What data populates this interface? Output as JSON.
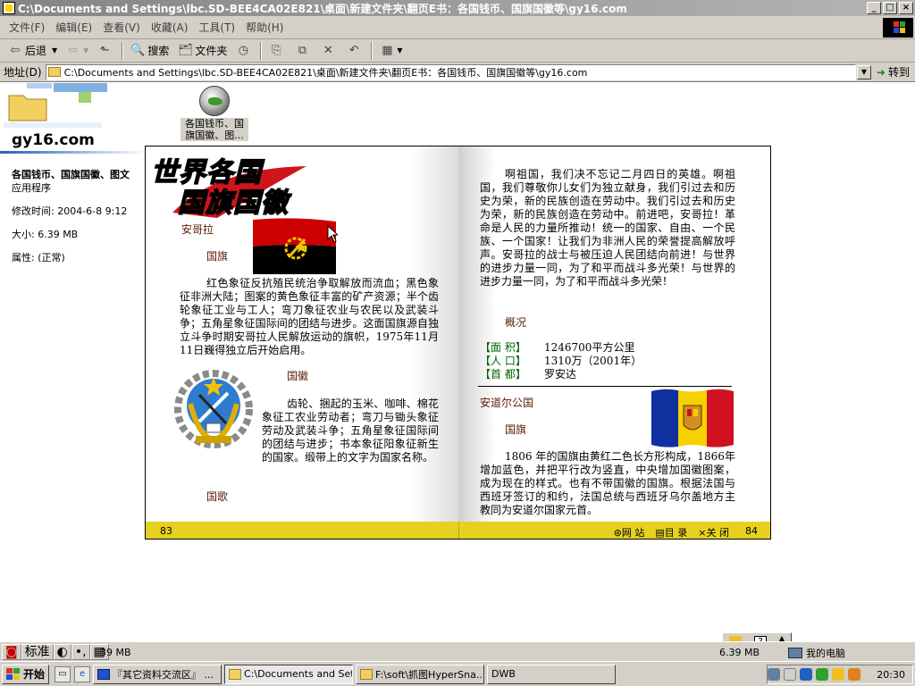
{
  "window": {
    "title": "C:\\Documents and Settings\\lbc.SD-BEE4CA02E821\\桌面\\新建文件夹\\翻页E书：各国钱币、国旗国徽等\\gy16.com",
    "buttons": {
      "minimize": "_",
      "maximize": "□",
      "close": "×"
    }
  },
  "menu": [
    "文件(F)",
    "编辑(E)",
    "查看(V)",
    "收藏(A)",
    "工具(T)",
    "帮助(H)"
  ],
  "toolbar": {
    "back": "后退",
    "search": "搜索",
    "folders": "文件夹"
  },
  "address": {
    "label": "地址(D)",
    "value": "C:\\Documents and Settings\\lbc.SD-BEE4CA02E821\\桌面\\新建文件夹\\翻页E书：各国钱币、国旗国徽等\\gy16.com",
    "go": "转到"
  },
  "info_panel": {
    "title": "gy16.com",
    "name": "各国钱币、国旗国徽、图文",
    "type": "应用程序",
    "modified": "修改时间: 2004-6-8 9:12",
    "size": "大小: 6.39 MB",
    "attributes": "属性: (正常)"
  },
  "file_icon": {
    "label": "各国钱币、国旗国徽、图..."
  },
  "book": {
    "title_line1": "世界各国",
    "title_line2": "国旗国徽",
    "left": {
      "country": "安哥拉",
      "flag_heading": "国旗",
      "flag_text": "红色象征反抗殖民统治争取解放而流血；黑色象征非洲大陆；图案的黄色象征丰富的矿产资源；半个齿轮象征工业与工人；弯刀象征农业与农民以及武装斗争；五角星象征国际间的团结与进步。这面国旗源自独立斗争时期安哥拉人民解放运动的旗帜，1975年11月11日巍得独立后开始启用。",
      "emblem_heading": "国徽",
      "emblem_text": "齿轮、捆起的玉米、咖啡、棉花象征工农业劳动者；弯刀与锄头象征劳动及武装斗争；五角星象征国际间的团结与进步；书本象征阳象征新生的国家。缎带上的文字为国家名称。",
      "anthem_heading": "国歌",
      "page_number": "83"
    },
    "right": {
      "anthem_text": "啊祖国，我们决不忘记二月四日的英雄。啊祖国，我们尊敬你儿女们为独立献身，我们引过去和历史为荣，新的民族创造在劳动中。我们引过去和历史为荣，新的民族创造在劳动中。前进吧，安哥拉！革命是人民的力量所推动！统一的国家、自由、一个民族、一个国家！让我们为非洲人民的荣誉提高解放呼声。安哥拉的战士与被压迫人民团结向前进！与世界的进步力量一同，为了和平而战斗多光荣！与世界的进步力量一同，为了和平而战斗多光荣！",
      "overview_heading": "概况",
      "stats": [
        {
          "key": "【面  积】",
          "value": "1246700平方公里"
        },
        {
          "key": "【人  口】",
          "value": "1310万（2001年）"
        },
        {
          "key": "【首  都】",
          "value": "罗安达"
        }
      ],
      "country2": "安道尔公国",
      "flag2_heading": "国旗",
      "flag2_text": "1806 年的国旗由黄红二色长方形构成，1866年增加蓝色，并把平行改为竖直，中央增加国徽图案，成为现在的样式。也有不带国徽的国旗。根据法国与西班牙签订的和约，法国总统与西班牙乌尔盖地方主教同为安道尔国家元首。",
      "page_number": "84"
    },
    "footer_links": {
      "site": "网 站",
      "contents": "目 录",
      "close": "关 闭"
    }
  },
  "statusbar": {
    "ime_mode": "标准",
    "size_left": "39 MB",
    "size_right": "6.39 MB",
    "zone": "我的电脑"
  },
  "taskbar": {
    "start": "开始",
    "tasks": [
      "『其它资料交流区』 ...",
      "C:\\Documents and Set...",
      "F:\\soft\\抓图HyperSna...",
      "DWB"
    ],
    "clock": "20:30"
  }
}
